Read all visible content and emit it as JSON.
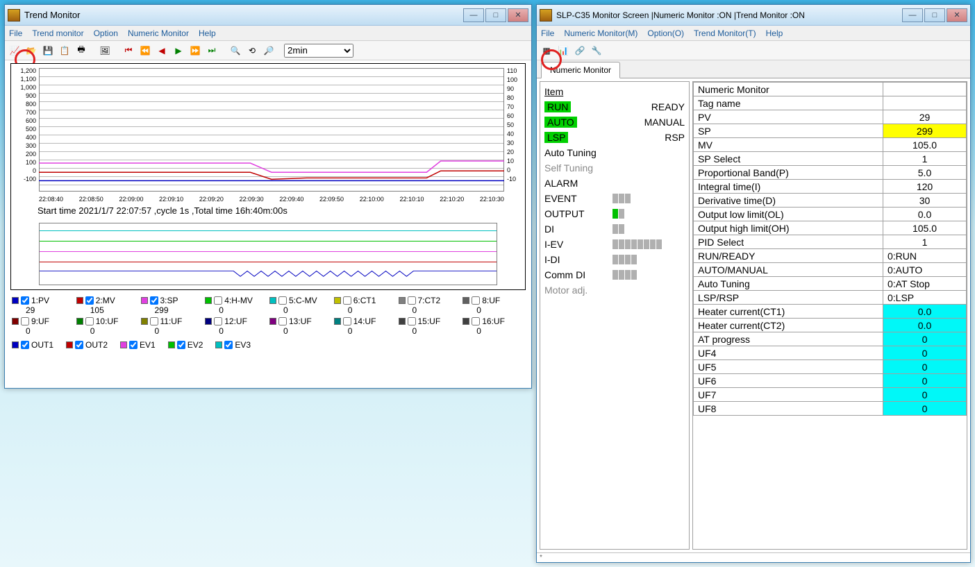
{
  "desktop": {},
  "trend_window": {
    "title": "Trend Monitor",
    "menus": [
      "File",
      "Trend monitor",
      "Option",
      "Numeric Monitor",
      "Help"
    ],
    "time_range": "2min",
    "start_time_line": "Start time 2021/1/7 22:07:57 ,cycle 1s ,Total time 16h:40m:00s",
    "yaxis_left": [
      "1,200",
      "1,100",
      "1,000",
      "900",
      "800",
      "700",
      "600",
      "500",
      "400",
      "300",
      "200",
      "100",
      "0",
      "-100"
    ],
    "yaxis_right": [
      "110",
      "100",
      "90",
      "80",
      "70",
      "60",
      "50",
      "40",
      "30",
      "20",
      "10",
      "0",
      "-10"
    ],
    "xaxis": [
      "22:08:40",
      "22:08:50",
      "22:09:00",
      "22:09:10",
      "22:09:20",
      "22:09:30",
      "22:09:40",
      "22:09:50",
      "22:10:00",
      "22:10:10",
      "22:10:20",
      "22:10:30"
    ],
    "legend": [
      {
        "color": "#0000c0",
        "checked": true,
        "label": "1:PV",
        "value": "29"
      },
      {
        "color": "#c00000",
        "checked": true,
        "label": "2:MV",
        "value": "105"
      },
      {
        "color": "#e040e0",
        "checked": true,
        "label": "3:SP",
        "value": "299"
      },
      {
        "color": "#00c000",
        "checked": false,
        "label": "4:H-MV",
        "value": "0"
      },
      {
        "color": "#00c0c0",
        "checked": false,
        "label": "5:C-MV",
        "value": "0"
      },
      {
        "color": "#c0c000",
        "checked": false,
        "label": "6:CT1",
        "value": "0"
      },
      {
        "color": "#808080",
        "checked": false,
        "label": "7:CT2",
        "value": "0"
      },
      {
        "color": "#606060",
        "checked": false,
        "label": "8:UF",
        "value": "0"
      },
      {
        "color": "#800000",
        "checked": false,
        "label": "9:UF",
        "value": "0"
      },
      {
        "color": "#008000",
        "checked": false,
        "label": "10:UF",
        "value": "0"
      },
      {
        "color": "#808000",
        "checked": false,
        "label": "11:UF",
        "value": "0"
      },
      {
        "color": "#000080",
        "checked": false,
        "label": "12:UF",
        "value": "0"
      },
      {
        "color": "#800080",
        "checked": false,
        "label": "13:UF",
        "value": "0"
      },
      {
        "color": "#008080",
        "checked": false,
        "label": "14:UF",
        "value": "0"
      },
      {
        "color": "#404040",
        "checked": false,
        "label": "15:UF",
        "value": "0"
      },
      {
        "color": "#404040",
        "checked": false,
        "label": "16:UF",
        "value": "0"
      }
    ],
    "legend2": [
      {
        "color": "#0000c0",
        "checked": true,
        "label": "OUT1"
      },
      {
        "color": "#c00000",
        "checked": true,
        "label": "OUT2"
      },
      {
        "color": "#e040e0",
        "checked": true,
        "label": "EV1"
      },
      {
        "color": "#00c000",
        "checked": true,
        "label": "EV2"
      },
      {
        "color": "#00c0c0",
        "checked": true,
        "label": "EV3"
      }
    ]
  },
  "slp_window": {
    "title": "SLP-C35 Monitor Screen |Numeric Monitor :ON |Trend Monitor :ON",
    "menus": [
      "File",
      "Numeric Monitor(M)",
      "Option(O)",
      "Trend Monitor(T)",
      "Help"
    ],
    "tab": "Numeric Monitor",
    "status": "*",
    "left": {
      "header": "Item",
      "modes": [
        {
          "on": "RUN",
          "off": "READY"
        },
        {
          "on": "AUTO",
          "off": "MANUAL"
        },
        {
          "on": "LSP",
          "off": "RSP"
        }
      ],
      "rows": [
        {
          "label": "Auto Tuning",
          "dim": false
        },
        {
          "label": "Self Tuning",
          "dim": true
        },
        {
          "label": "ALARM",
          "dim": false
        },
        {
          "label": "EVENT",
          "dim": false,
          "ind": [
            0,
            0,
            0
          ]
        },
        {
          "label": "OUTPUT",
          "dim": false,
          "ind": [
            1,
            0
          ]
        },
        {
          "label": "DI",
          "dim": false,
          "ind": [
            0,
            0
          ]
        },
        {
          "label": "I-EV",
          "dim": false,
          "ind": [
            0,
            0,
            0,
            0,
            0,
            0,
            0,
            0
          ]
        },
        {
          "label": "I-DI",
          "dim": false,
          "ind": [
            0,
            0,
            0,
            0
          ]
        },
        {
          "label": "Comm DI",
          "dim": false,
          "ind": [
            0,
            0,
            0,
            0
          ]
        },
        {
          "label": "Motor adj.",
          "dim": true
        }
      ]
    },
    "table": [
      {
        "k": "Numeric Monitor",
        "v": ""
      },
      {
        "k": "Tag name",
        "v": ""
      },
      {
        "k": "PV",
        "v": "29"
      },
      {
        "k": "SP",
        "v": "299",
        "hl": "yellow"
      },
      {
        "k": "MV",
        "v": "105.0"
      },
      {
        "k": "SP Select",
        "v": "1"
      },
      {
        "k": "Proportional Band(P)",
        "v": "5.0"
      },
      {
        "k": "Integral time(I)",
        "v": "120"
      },
      {
        "k": "Derivative time(D)",
        "v": "30"
      },
      {
        "k": "Output low limit(OL)",
        "v": "0.0"
      },
      {
        "k": "Output high limit(OH)",
        "v": "105.0"
      },
      {
        "k": "PID Select",
        "v": "1"
      },
      {
        "k": "RUN/READY",
        "v": "0:RUN"
      },
      {
        "k": "AUTO/MANUAL",
        "v": "0:AUTO"
      },
      {
        "k": "Auto Tuning",
        "v": "0:AT Stop"
      },
      {
        "k": "LSP/RSP",
        "v": "0:LSP"
      },
      {
        "k": "Heater current(CT1)",
        "v": "0.0",
        "hl": "cyan"
      },
      {
        "k": "Heater current(CT2)",
        "v": "0.0",
        "hl": "cyan"
      },
      {
        "k": "AT progress",
        "v": "0",
        "hl": "cyan"
      },
      {
        "k": "UF4",
        "v": "0",
        "hl": "cyan"
      },
      {
        "k": "UF5",
        "v": "0",
        "hl": "cyan"
      },
      {
        "k": "UF6",
        "v": "0",
        "hl": "cyan"
      },
      {
        "k": "UF7",
        "v": "0",
        "hl": "cyan"
      },
      {
        "k": "UF8",
        "v": "0",
        "hl": "cyan"
      }
    ]
  },
  "chart_data": {
    "type": "line",
    "title": "Trend Monitor",
    "x": [
      "22:08:40",
      "22:08:50",
      "22:09:00",
      "22:09:10",
      "22:09:20",
      "22:09:30",
      "22:09:40",
      "22:09:50",
      "22:10:00",
      "22:10:10",
      "22:10:20",
      "22:10:30"
    ],
    "y_left": {
      "min": -100,
      "max": 1200,
      "label": ""
    },
    "y_right": {
      "min": -10,
      "max": 110,
      "label": ""
    },
    "series": [
      {
        "name": "1:PV",
        "axis": "left",
        "color": "#0000c0",
        "values": [
          29,
          29,
          29,
          29,
          29,
          29,
          29,
          29,
          29,
          29,
          29,
          29
        ]
      },
      {
        "name": "2:MV",
        "axis": "right",
        "color": "#c00000",
        "values": [
          20,
          20,
          20,
          20,
          20,
          15,
          12,
          12,
          12,
          12,
          18,
          20
        ]
      },
      {
        "name": "3:SP",
        "axis": "left",
        "color": "#e040e0",
        "values": [
          299,
          299,
          299,
          299,
          299,
          200,
          150,
          150,
          150,
          150,
          300,
          300
        ]
      }
    ],
    "digital_series": [
      {
        "name": "OUT1",
        "color": "#0000c0"
      },
      {
        "name": "OUT2",
        "color": "#c00000"
      },
      {
        "name": "EV1",
        "color": "#e040e0"
      },
      {
        "name": "EV2",
        "color": "#00c000"
      },
      {
        "name": "EV3",
        "color": "#00c0c0"
      }
    ]
  }
}
